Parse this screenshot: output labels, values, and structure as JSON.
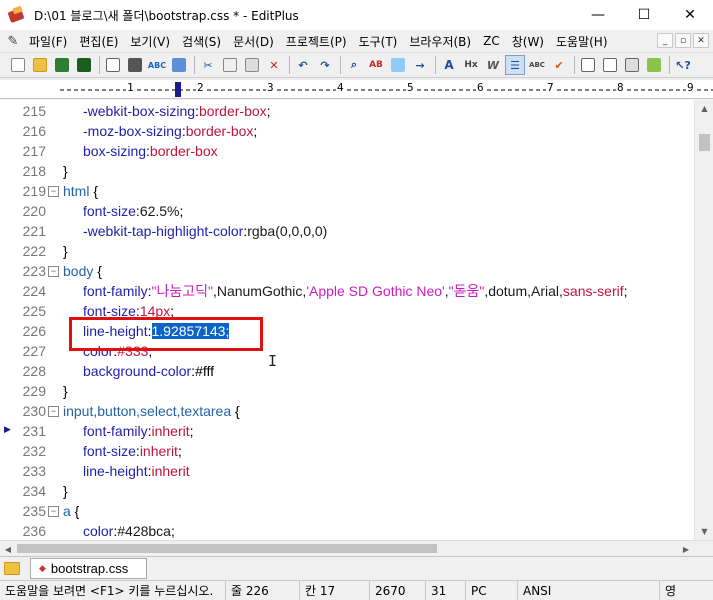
{
  "window": {
    "title": "D:\\01 블로그\\새 폴더\\bootstrap.css * - EditPlus",
    "minimize": "—",
    "maximize": "☐",
    "close": "✕"
  },
  "menu": [
    "파일(F)",
    "편집(E)",
    "보기(V)",
    "검색(S)",
    "문서(D)",
    "프로젝트(P)",
    "도구(T)",
    "브라우저(B)",
    "ZC",
    "창(W)",
    "도움말(H)"
  ],
  "ruler": {
    "numbers": [
      "1",
      "2",
      "3",
      "4",
      "5",
      "6",
      "7",
      "8",
      "9"
    ]
  },
  "editor": {
    "selected_text": "1.92857143;",
    "lines": [
      {
        "n": "215",
        "fold": "",
        "parts": [
          [
            "-webkit-box-sizing",
            "prop"
          ],
          [
            ":",
            "sym"
          ],
          [
            "border-box",
            "val"
          ],
          [
            ";",
            "sym"
          ]
        ],
        "indent": true
      },
      {
        "n": "216",
        "fold": "",
        "parts": [
          [
            "-moz-box-sizing",
            "prop"
          ],
          [
            ":",
            "sym"
          ],
          [
            "border-box",
            "val"
          ],
          [
            ";",
            "sym"
          ]
        ],
        "indent": true
      },
      {
        "n": "217",
        "fold": "",
        "parts": [
          [
            "box-sizing",
            "prop"
          ],
          [
            ":",
            "sym"
          ],
          [
            "border-box",
            "val"
          ]
        ],
        "indent": true
      },
      {
        "n": "218",
        "fold": "",
        "parts": [
          [
            "}",
            "sym"
          ]
        ],
        "indent": false
      },
      {
        "n": "219",
        "fold": "⊟",
        "parts": [
          [
            "html",
            "sel"
          ],
          [
            " {",
            "sym"
          ]
        ],
        "indent": false
      },
      {
        "n": "220",
        "fold": "",
        "parts": [
          [
            "font-size",
            "prop"
          ],
          [
            ":",
            "sym"
          ],
          [
            "62.5%",
            "num"
          ],
          [
            ";",
            "sym"
          ]
        ],
        "indent": true
      },
      {
        "n": "221",
        "fold": "",
        "parts": [
          [
            "-webkit-tap-highlight-color",
            "prop"
          ],
          [
            ":",
            "sym"
          ],
          [
            "rgba(0,0,0,0)",
            "num"
          ]
        ],
        "indent": true
      },
      {
        "n": "222",
        "fold": "",
        "parts": [
          [
            "}",
            "sym"
          ]
        ],
        "indent": false
      },
      {
        "n": "223",
        "fold": "⊟",
        "parts": [
          [
            "body",
            "sel"
          ],
          [
            " {",
            "sym"
          ]
        ],
        "indent": false
      },
      {
        "n": "224",
        "fold": "",
        "parts": [
          [
            "font-family",
            "prop"
          ],
          [
            ":",
            "sym"
          ],
          [
            "\"나눔고딕\"",
            "str"
          ],
          [
            ",NanumGothic,",
            "num"
          ],
          [
            "'Apple SD Gothic Neo'",
            "str"
          ],
          [
            ",",
            "num"
          ],
          [
            "\"돋움\"",
            "str"
          ],
          [
            ",dotum,Arial,",
            "num"
          ],
          [
            "sans-serif",
            "val"
          ],
          [
            ";",
            "sym"
          ]
        ],
        "indent": true
      },
      {
        "n": "225",
        "fold": "",
        "parts": [
          [
            "font-size",
            "prop"
          ],
          [
            ":",
            "sym"
          ],
          [
            "14px",
            "val"
          ],
          [
            ";",
            "sym"
          ]
        ],
        "indent": true
      },
      {
        "n": "226",
        "fold": "",
        "parts": [
          [
            "line-height",
            "prop"
          ],
          [
            ":",
            "sym"
          ],
          [
            "1.92857143;",
            "selected"
          ]
        ],
        "indent": true
      },
      {
        "n": "227",
        "fold": "",
        "parts": [
          [
            "color",
            "prop"
          ],
          [
            ":",
            "sym"
          ],
          [
            "#333",
            "val"
          ],
          [
            ";",
            "sym"
          ]
        ],
        "indent": true
      },
      {
        "n": "228",
        "fold": "",
        "parts": [
          [
            "background-color",
            "prop"
          ],
          [
            ":",
            "sym"
          ],
          [
            "#fff",
            "high"
          ]
        ],
        "indent": true
      },
      {
        "n": "229",
        "fold": "",
        "parts": [
          [
            "}",
            "sym"
          ]
        ],
        "indent": false
      },
      {
        "n": "230",
        "fold": "⊟",
        "parts": [
          [
            "input,button,select,textarea",
            "sel"
          ],
          [
            " {",
            "sym"
          ]
        ],
        "indent": false
      },
      {
        "n": "231",
        "fold": "",
        "parts": [
          [
            "font-family",
            "prop"
          ],
          [
            ":",
            "sym"
          ],
          [
            "inherit",
            "val"
          ],
          [
            ";",
            "sym"
          ]
        ],
        "indent": true
      },
      {
        "n": "232",
        "fold": "",
        "parts": [
          [
            "font-size",
            "prop"
          ],
          [
            ":",
            "sym"
          ],
          [
            "inherit",
            "val"
          ],
          [
            ";",
            "sym"
          ]
        ],
        "indent": true
      },
      {
        "n": "233",
        "fold": "",
        "parts": [
          [
            "line-height",
            "prop"
          ],
          [
            ":",
            "sym"
          ],
          [
            "inherit",
            "val"
          ]
        ],
        "indent": true
      },
      {
        "n": "234",
        "fold": "",
        "parts": [
          [
            "}",
            "sym"
          ]
        ],
        "indent": false
      },
      {
        "n": "235",
        "fold": "⊟",
        "parts": [
          [
            "a",
            "sel"
          ],
          [
            " {",
            "sym"
          ]
        ],
        "indent": false
      },
      {
        "n": "236",
        "fold": "",
        "parts": [
          [
            "color",
            "prop"
          ],
          [
            ":",
            "sym"
          ],
          [
            "#428bca",
            "num"
          ],
          [
            ";",
            "sym"
          ]
        ],
        "indent": true
      }
    ]
  },
  "tabs": [
    {
      "label": "bootstrap.css"
    }
  ],
  "status": {
    "help": "도움말을 보려면 <F1> 키를 누르십시오.",
    "line": "줄 226",
    "col": "칸 17",
    "offset": "2670",
    "count": "31",
    "eol": "PC",
    "encoding": "ANSI",
    "ime": "영"
  },
  "colors": {
    "selector": "#2563a6",
    "property": "#1f1fa8",
    "value": "#c0143c",
    "string": "#c81ec0",
    "selection": "#0a64c8",
    "highlight_box": "#e01010"
  }
}
